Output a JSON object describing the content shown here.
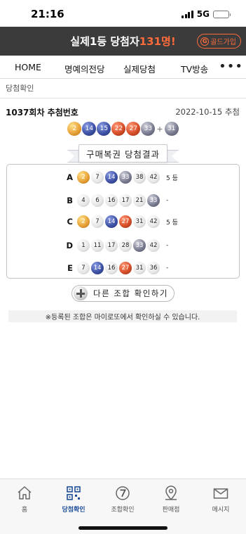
{
  "status_bar": {
    "time": "21:16",
    "network": "5G"
  },
  "banner": {
    "text_prefix": "실제1등 당첨자",
    "text_highlight": "131명!",
    "gold_button": {
      "icon": "G",
      "label": "골드가입"
    }
  },
  "nav": {
    "items": [
      "HOME",
      "명예의전당",
      "실제당첨",
      "TV방송"
    ],
    "more": "•••"
  },
  "breadcrumb": "당첨확인",
  "round": {
    "title": "1037회차 추첨번호",
    "date": "2022-10-15 추첨"
  },
  "winning": {
    "numbers": [
      {
        "n": "2",
        "color": "yellow"
      },
      {
        "n": "14",
        "color": "blue"
      },
      {
        "n": "15",
        "color": "blue"
      },
      {
        "n": "22",
        "color": "red"
      },
      {
        "n": "27",
        "color": "red"
      },
      {
        "n": "33",
        "color": "gray"
      }
    ],
    "plus": "+",
    "bonus": {
      "n": "31",
      "color": "gray"
    }
  },
  "results_title": "구매복권 당첨결과",
  "results": [
    {
      "label": "A",
      "rank": "5 등",
      "balls": [
        {
          "n": "2",
          "c": "y"
        },
        {
          "n": "7",
          "c": "w"
        },
        {
          "n": "14",
          "c": "b"
        },
        {
          "n": "33",
          "c": "g"
        },
        {
          "n": "38",
          "c": "w"
        },
        {
          "n": "42",
          "c": "w"
        }
      ]
    },
    {
      "label": "B",
      "rank": "-",
      "balls": [
        {
          "n": "4",
          "c": "w"
        },
        {
          "n": "6",
          "c": "w"
        },
        {
          "n": "16",
          "c": "w"
        },
        {
          "n": "17",
          "c": "w"
        },
        {
          "n": "21",
          "c": "w"
        },
        {
          "n": "33",
          "c": "g"
        }
      ]
    },
    {
      "label": "C",
      "rank": "5 등",
      "balls": [
        {
          "n": "2",
          "c": "y"
        },
        {
          "n": "7",
          "c": "w"
        },
        {
          "n": "14",
          "c": "b"
        },
        {
          "n": "27",
          "c": "r"
        },
        {
          "n": "31",
          "c": "w"
        },
        {
          "n": "42",
          "c": "w"
        }
      ]
    },
    {
      "label": "D",
      "rank": "-",
      "balls": [
        {
          "n": "1",
          "c": "w"
        },
        {
          "n": "11",
          "c": "w"
        },
        {
          "n": "17",
          "c": "w"
        },
        {
          "n": "28",
          "c": "w"
        },
        {
          "n": "33",
          "c": "g"
        },
        {
          "n": "42",
          "c": "w"
        }
      ]
    },
    {
      "label": "E",
      "rank": "-",
      "balls": [
        {
          "n": "7",
          "c": "w"
        },
        {
          "n": "14",
          "c": "b"
        },
        {
          "n": "16",
          "c": "w"
        },
        {
          "n": "27",
          "c": "r"
        },
        {
          "n": "31",
          "c": "w"
        },
        {
          "n": "36",
          "c": "w"
        }
      ]
    }
  ],
  "add_button": "다른 조합 확인하기",
  "notice": "※등록된 조합은 마이로또에서 확인하실 수 있습니다.",
  "tab_bar": {
    "items": [
      {
        "label": "홈",
        "icon": "home-icon"
      },
      {
        "label": "당첨확인",
        "icon": "qr-icon",
        "active": true
      },
      {
        "label": "조합확인",
        "icon": "number-seven-icon"
      },
      {
        "label": "판매점",
        "icon": "location-pin-icon"
      },
      {
        "label": "메시지",
        "icon": "envelope-icon"
      }
    ]
  },
  "colors": {
    "accent": "#ff6b3a",
    "banner_bg": "#3b3b3b",
    "tab_active": "#1e4f9a"
  }
}
